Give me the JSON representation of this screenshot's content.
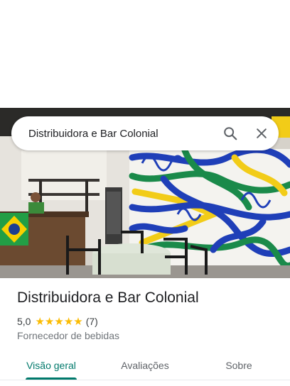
{
  "search": {
    "query": "Distribuidora e Bar Colonial",
    "search_icon": "search-icon",
    "close_icon": "close-icon"
  },
  "place": {
    "name": "Distribuidora e Bar Colonial",
    "rating": "5,0",
    "stars": 5,
    "review_count": "(7)",
    "category": "Fornecedor de bebidas"
  },
  "tabs": [
    {
      "label": "Visão geral",
      "active": true
    },
    {
      "label": "Avaliações",
      "active": false
    },
    {
      "label": "Sobre",
      "active": false
    }
  ],
  "colors": {
    "accent": "#00796b",
    "star": "#fbbc04",
    "text_primary": "#202124",
    "text_secondary": "#70757a"
  }
}
